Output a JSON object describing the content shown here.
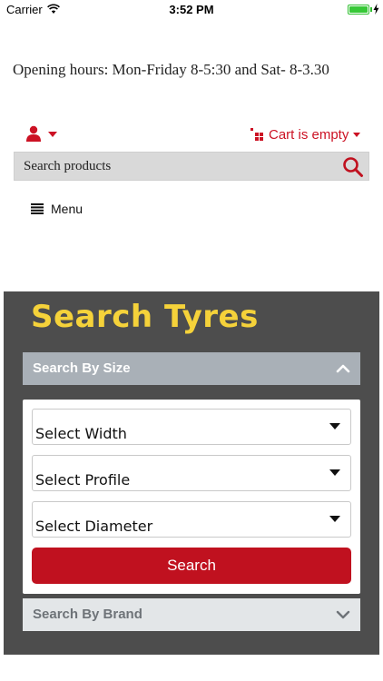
{
  "status_bar": {
    "carrier": "Carrier",
    "time": "3:52 PM",
    "battery_level": 1.0,
    "icons": [
      "wifi-icon",
      "battery-icon",
      "charging-bolt-icon"
    ]
  },
  "header": {
    "opening_hours": "Opening hours: Mon-Friday 8-5:30 and Sat- 8-3.30",
    "account_icon": "user-icon",
    "cart_label": "Cart is empty",
    "cart_icon": "cart-icon"
  },
  "search": {
    "placeholder": "Search products",
    "icon": "search-icon"
  },
  "menu": {
    "label": "Menu",
    "icon": "hamburger-icon"
  },
  "tyre_search": {
    "title": "Search Tyres",
    "by_size": {
      "label": "Search By Size",
      "expanded": true,
      "selects": [
        {
          "value": "Select Width"
        },
        {
          "value": "Select Profile"
        },
        {
          "value": "Select Diameter"
        }
      ],
      "button_label": "Search"
    },
    "by_brand": {
      "label": "Search By Brand",
      "expanded": false
    }
  },
  "colors": {
    "accent_red": "#c0111f",
    "cart_red": "#cc1224",
    "title_yellow": "#f5d23a",
    "panel_bg": "#4d4d4d",
    "accordion_active": "#a9b0b7",
    "accordion_inactive": "#e3e6e8"
  }
}
